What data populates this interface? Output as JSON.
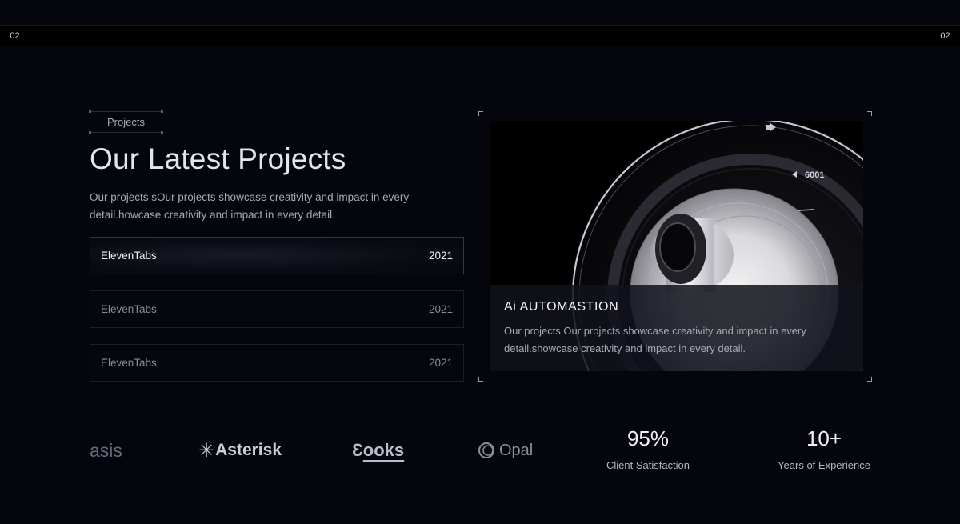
{
  "topbar": {
    "left_number": "02",
    "right_number": "02"
  },
  "section": {
    "tag": "Projects",
    "title": "Our Latest Projects",
    "description": "Our projects sOur projects showcase creativity and impact in every detail.howcase creativity and impact in every detail."
  },
  "projects": [
    {
      "name": "ElevenTabs",
      "year": "2021",
      "active": true
    },
    {
      "name": "ElevenTabs",
      "year": "2021",
      "active": false
    },
    {
      "name": "ElevenTabs",
      "year": "2021",
      "active": false
    }
  ],
  "featured": {
    "title": "Ai AUTOMASTION",
    "description": "Our projects Our projects showcase creativity and impact in every detail.showcase creativity and impact in every detail.",
    "image_label": "6001"
  },
  "logos": [
    {
      "name": "oasis",
      "text": "asis"
    },
    {
      "name": "asterisk",
      "text": "Asterisk",
      "icon": "asterisk-icon"
    },
    {
      "name": "books",
      "text": "ooks",
      "icon": "books-icon"
    },
    {
      "name": "opal",
      "text": "Opal",
      "icon": "opal-ring-icon"
    }
  ],
  "stats": [
    {
      "value": "95%",
      "label": "Client Satisfaction"
    },
    {
      "value": "10+",
      "label": "Years of Experience"
    }
  ],
  "colors": {
    "background": "#05050d",
    "topbar": "#000000",
    "text_primary": "#e6e6ee",
    "text_secondary": "#a9a9b6",
    "border": "#1e1e2b"
  }
}
